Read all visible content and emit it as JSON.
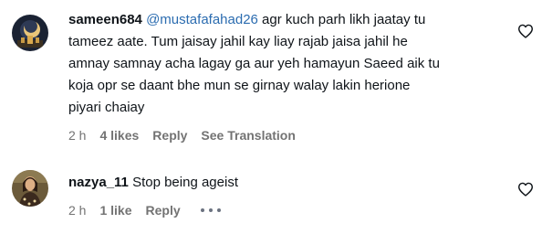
{
  "comments": [
    {
      "username": "sameen684",
      "mention": "@mustafafahad26",
      "text_line1": " agr kuch parh likh jaatay tu",
      "text_line2": "tameez aate. Tum jaisay jahil kay liay rajab jaisa jahil he",
      "text_line3": "amnay samnay acha lagay ga aur yeh hamayun Saeed aik tu",
      "text_line4": "koja opr se daant bhe mun se girnay walay lakin herione",
      "text_line5": "piyari chaiay",
      "time": "2 h",
      "likes": "4 likes",
      "reply": "Reply",
      "translate": "See Translation"
    },
    {
      "username": "nazya_11",
      "text": "Stop being ageist",
      "time": "2 h",
      "likes": "1 like",
      "reply": "Reply"
    }
  ],
  "icons": {
    "like": "heart-icon",
    "more": "more-options-icon"
  },
  "colors": {
    "mention": "#2b6cb0",
    "meta": "#737373",
    "text": "#0f1419"
  }
}
